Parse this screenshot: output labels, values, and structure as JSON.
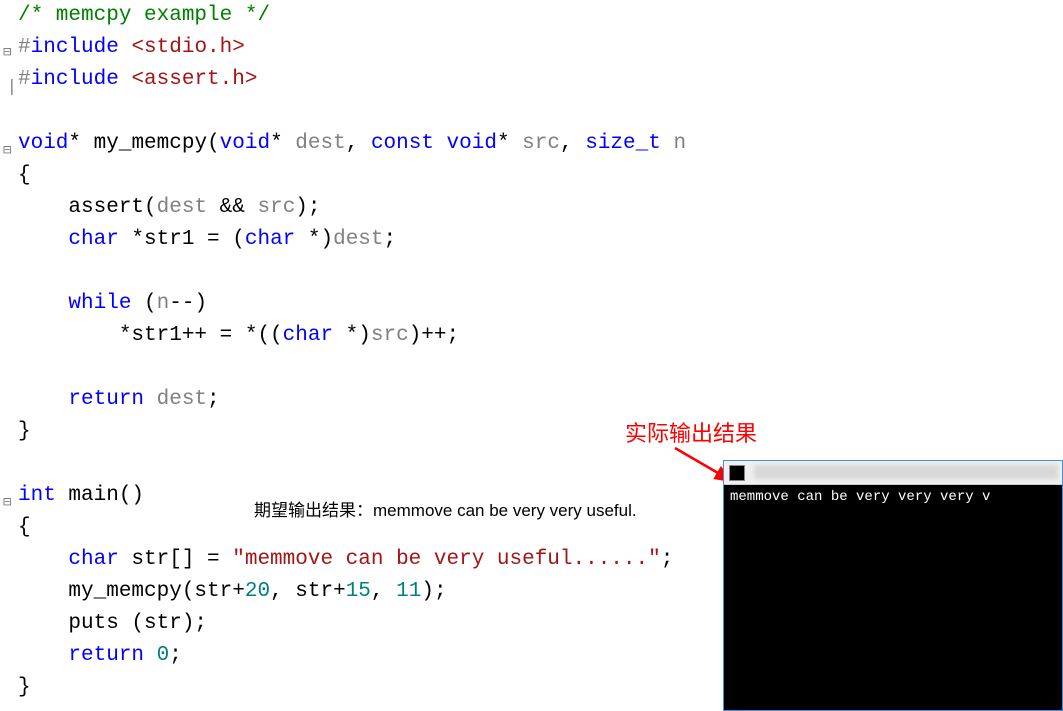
{
  "code": {
    "line1_comment": "/* memcpy example */",
    "line2_include": "#include <stdio.h>",
    "line2_hash": "#",
    "line2_include_kw": "include",
    "line2_header": "<stdio.h>",
    "line3_hash": "#",
    "line3_include_kw": "include",
    "line3_header": "<assert.h>",
    "line5_void": "void",
    "line5_star": "*",
    "line5_fname": " my_memcpy",
    "line5_paren_open": "(",
    "line5_void2": "void",
    "line5_star2": "*",
    "line5_dest": " dest",
    "line5_comma": ", ",
    "line5_const": "const void",
    "line5_star3": "*",
    "line5_src": " src",
    "line5_comma2": ", ",
    "line5_sizet": "size_t ",
    "line5_n": "n",
    "line6_brace": "{",
    "line7_assert": "    assert",
    "line7_args": "(dest && src);",
    "line7_p1": "(",
    "line7_dest": "dest",
    "line7_and": " && ",
    "line7_src": "src",
    "line7_p2": ")",
    "line7_semi": ";",
    "line8_char": "    char ",
    "line8_star": "*",
    "line8_str1": "str1 = (",
    "line8_char2": "char ",
    "line8_star2": "*",
    "line8_p2": ")",
    "line8_dest": "dest",
    "line8_semi": ";",
    "line10_while": "    while ",
    "line10_p1": "(",
    "line10_n": "n",
    "line10_dec": "--)",
    "line11_body": "        *str1++ = *((",
    "line11_char": "char ",
    "line11_star": "*",
    "line11_p": ")",
    "line11_src": "src",
    "line11_rest": ")++;",
    "line13_return": "    return ",
    "line13_dest": "dest",
    "line13_semi": ";",
    "line14_brace": "}",
    "line16_int": "int",
    "line16_main": " main()",
    "line17_brace": "{",
    "line18_char": "    char ",
    "line18_str": "str[] = ",
    "line18_string": "\"memmove can be very useful......\"",
    "line18_semi": ";",
    "line19_call": "    my_memcpy(str+",
    "line19_20": "20",
    "line19_mid": ", str+",
    "line19_15": "15",
    "line19_mid2": ", ",
    "line19_11": "11",
    "line19_end": ");",
    "line20_puts": "    puts (str);",
    "line21_return": "    return ",
    "line21_zero": "0",
    "line21_semi": ";",
    "line22_brace": "}"
  },
  "annotations": {
    "expected_label": "期望输出结果：memmove can be very very useful.",
    "actual_label": "实际输出结果"
  },
  "console": {
    "output": "memmove can be very very very v"
  }
}
